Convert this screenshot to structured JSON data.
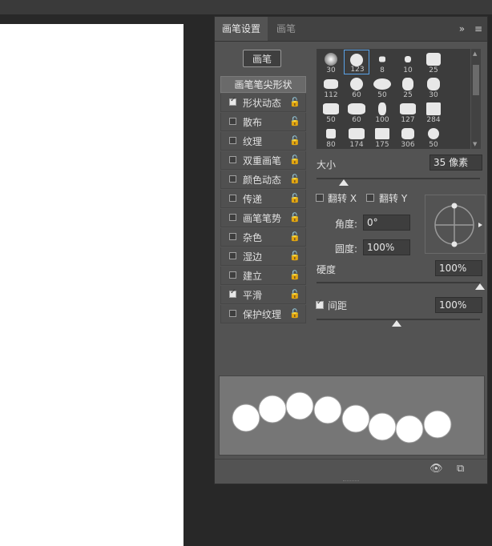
{
  "tabs": {
    "active": "画笔设置",
    "inactive": "画笔"
  },
  "tab_icons": {
    "collapse": "»",
    "menu": "≡"
  },
  "brush_button": "画笔",
  "tip_shape_header": "画笔笔尖形状",
  "options": [
    {
      "label": "形状动态",
      "checked": true
    },
    {
      "label": "散布",
      "checked": false
    },
    {
      "label": "纹理",
      "checked": false
    },
    {
      "label": "双重画笔",
      "checked": false
    },
    {
      "label": "颜色动态",
      "checked": false
    },
    {
      "label": "传递",
      "checked": false
    },
    {
      "label": "画笔笔势",
      "checked": false
    },
    {
      "label": "杂色",
      "checked": false
    },
    {
      "label": "湿边",
      "checked": false
    },
    {
      "label": "建立",
      "checked": false
    },
    {
      "label": "平滑",
      "checked": true
    },
    {
      "label": "保护纹理",
      "checked": false
    }
  ],
  "brushes": [
    "30",
    "123",
    "8",
    "10",
    "25",
    "112",
    "60",
    "50",
    "25",
    "30",
    "50",
    "60",
    "100",
    "127",
    "284",
    "80",
    "174",
    "175",
    "306",
    "50"
  ],
  "selected_brush": "123",
  "size": {
    "label": "大小",
    "value": "35 像素"
  },
  "flip_x": {
    "label": "翻转 X",
    "checked": false
  },
  "flip_y": {
    "label": "翻转 Y",
    "checked": false
  },
  "angle": {
    "label": "角度:",
    "value": "0°"
  },
  "roundness": {
    "label": "圆度:",
    "value": "100%"
  },
  "hardness": {
    "label": "硬度",
    "value": "100%"
  },
  "spacing": {
    "label": "间距",
    "value": "100%",
    "checked": true
  },
  "footer_icons": [
    "eye-brush-icon",
    "new-preset-icon"
  ]
}
